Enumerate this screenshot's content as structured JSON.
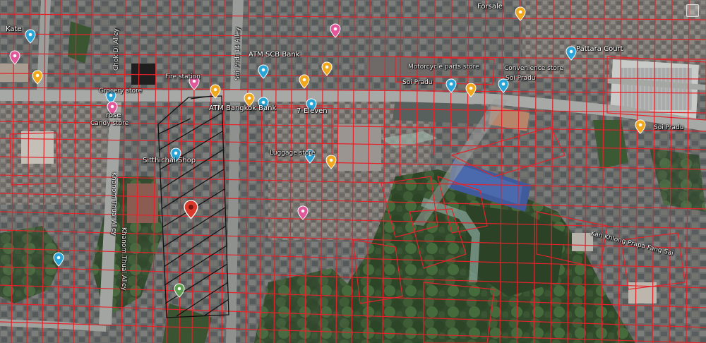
{
  "labels": {
    "kate": "Kate",
    "forsale": "Forsale",
    "pattara_court": "Pattara Court",
    "chok_di_alley": "Chok Di Alley",
    "soi_pridi_alley": "Soi Pridi 14 Alley",
    "atm_scb": "ATM SCB Bank",
    "atm_bangkok": "ATM Bangkok Bank",
    "grocery": "Grocery store",
    "fire_station": "Fire station",
    "candy": "Candy store",
    "rose": "rose",
    "sitthichai": "Sitthichai Shop",
    "seven_eleven": "7-Eleven",
    "luggage": "Luggage store",
    "soi_pradu_1": "Soi Pradu",
    "soi_pradu_2": "Soi Pradu",
    "soi_pradu_3": "Soi Pradu",
    "motorcycle": "Motorcycle parts store",
    "convenience": "Convenience store",
    "khanom_thuai_1": "Khanom Thuai Alley",
    "khanom_thuai_2": "Khanom Thuai Alley",
    "kan_khlong": "Kan Khlong Prapa Fang Sai"
  },
  "colors": {
    "parcel_line": "#e4232b",
    "hatch_line": "#111111",
    "pin_orange": "#f2a81d",
    "pin_blue": "#2aa5d8",
    "pin_pink": "#e2569a",
    "pin_red": "#d93a2b",
    "pin_green": "#5f9e4f"
  },
  "pins": [
    {
      "name": "kate-pin",
      "icon": "shopping-bag-icon",
      "color": "pin_blue"
    },
    {
      "name": "pink-pin-left",
      "icon": "restaurant-icon",
      "color": "pin_pink"
    },
    {
      "name": "orange-pin-left",
      "icon": "shop-icon",
      "color": "pin_orange"
    },
    {
      "name": "fire-station-pin",
      "icon": "fire-station-icon",
      "color": "pin_pink"
    },
    {
      "name": "grocery-pin",
      "icon": "grocery-icon",
      "color": "pin_blue"
    },
    {
      "name": "atm-scb-pin",
      "icon": "atm-icon",
      "color": "pin_blue"
    },
    {
      "name": "atm-bangkok-pin",
      "icon": "atm-icon",
      "color": "pin_blue"
    },
    {
      "name": "orange-pin-road",
      "icon": "shop-icon",
      "color": "pin_orange"
    },
    {
      "name": "orange-pin-road-2",
      "icon": "shop-icon",
      "color": "pin_orange"
    },
    {
      "name": "candy-pin",
      "icon": "candy-icon",
      "color": "pin_pink"
    },
    {
      "name": "sitthichai-pin",
      "icon": "shopping-bag-icon",
      "color": "pin_blue"
    },
    {
      "name": "seven-eleven-pin",
      "icon": "shopping-bag-icon",
      "color": "pin_blue"
    },
    {
      "name": "luggage-pin",
      "icon": "shopping-bag-icon",
      "color": "pin_blue"
    },
    {
      "name": "orange-pin-center",
      "icon": "shop-icon",
      "color": "pin_orange"
    },
    {
      "name": "pink-pin-top",
      "icon": "restaurant-icon",
      "color": "pin_pink"
    },
    {
      "name": "orange-pin-top",
      "icon": "shop-icon",
      "color": "pin_orange"
    },
    {
      "name": "orange-pin-top-2",
      "icon": "shop-icon",
      "color": "pin_orange"
    },
    {
      "name": "motorcycle-pin",
      "icon": "shopping-bag-icon",
      "color": "pin_blue"
    },
    {
      "name": "convenience-pin",
      "icon": "shopping-bag-icon",
      "color": "pin_blue"
    },
    {
      "name": "orange-pin-soi-pradu",
      "icon": "shop-icon",
      "color": "pin_orange"
    },
    {
      "name": "forsale-pin",
      "icon": "shop-icon",
      "color": "pin_orange"
    },
    {
      "name": "pattara-court-pin",
      "icon": "building-icon",
      "color": "pin_blue"
    },
    {
      "name": "orange-pin-right",
      "icon": "shop-icon",
      "color": "pin_orange"
    },
    {
      "name": "pink-pin-lower",
      "icon": "restaurant-icon",
      "color": "pin_pink"
    },
    {
      "name": "selected-location-pin",
      "icon": "location-pin-icon",
      "color": "pin_red"
    },
    {
      "name": "park-pin",
      "icon": "park-icon",
      "color": "pin_green"
    },
    {
      "name": "blue-pin-lower-left",
      "icon": "shopping-bag-icon",
      "color": "pin_blue"
    }
  ]
}
